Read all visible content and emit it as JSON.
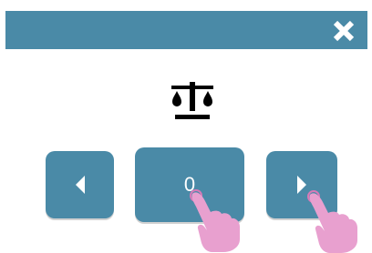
{
  "counter": {
    "value": "0"
  },
  "colors": {
    "accent": "#4a8aa7",
    "pointer_hand": "#e8a0cf",
    "icon": "#000000"
  },
  "icons": {
    "close": "close-icon",
    "scale": "scale-icon",
    "left_arrow": "triangle-left-icon",
    "right_arrow": "triangle-right-icon",
    "pointer": "pointing-hand-icon"
  }
}
